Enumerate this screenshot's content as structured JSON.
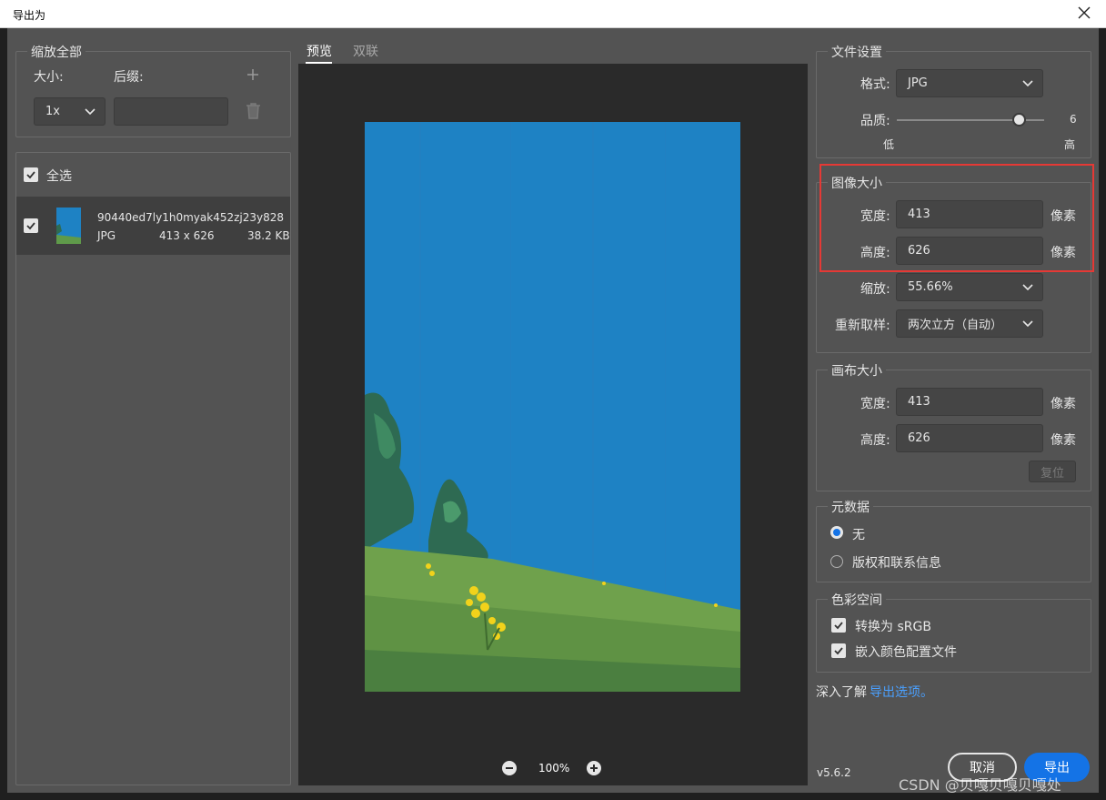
{
  "window": {
    "title": "导出为"
  },
  "left": {
    "scale_all": {
      "legend": "缩放全部",
      "size_label": "大小:",
      "suffix_label": "后缀:",
      "size_value": "1x",
      "suffix_value": ""
    },
    "select_all_label": "全选",
    "file": {
      "name": "90440ed7ly1h0myak452zj23y828",
      "format": "JPG",
      "dimensions": "413 x 626",
      "filesize": "38.2 KB",
      "checked": true
    }
  },
  "preview": {
    "tabs": [
      "预览",
      "双联"
    ],
    "active_tab": "预览",
    "zoom": "100%"
  },
  "file_settings": {
    "legend": "文件设置",
    "format_label": "格式:",
    "format_value": "JPG",
    "quality_label": "品质:",
    "quality_value": "6",
    "quality_min": 1,
    "quality_max": 7,
    "quality_low": "低",
    "quality_high": "高"
  },
  "image_size": {
    "legend": "图像大小",
    "width_label": "宽度:",
    "width_value": "413",
    "height_label": "高度:",
    "height_value": "626",
    "unit": "像素",
    "scale_label": "缩放:",
    "scale_value": "55.66%",
    "resample_label": "重新取样:",
    "resample_value": "两次立方（自动）"
  },
  "canvas_size": {
    "legend": "画布大小",
    "width_label": "宽度:",
    "width_value": "413",
    "height_label": "高度:",
    "height_value": "626",
    "unit": "像素",
    "reset_label": "复位"
  },
  "metadata": {
    "legend": "元数据",
    "options": [
      "无",
      "版权和联系信息"
    ],
    "selected": "无"
  },
  "color_space": {
    "legend": "色彩空间",
    "convert_label": "转换为 sRGB",
    "embed_label": "嵌入颜色配置文件"
  },
  "learn_more": {
    "prefix": "深入了解",
    "link": "导出选项。"
  },
  "footer": {
    "version": "v5.6.2",
    "cancel_label": "取消",
    "export_label": "导出",
    "watermark": "CSDN @贝嘎贝嘎贝嘎处"
  },
  "colors": {
    "accent": "#1473e6",
    "highlight": "#e53935",
    "sky": "#1e82c4"
  }
}
